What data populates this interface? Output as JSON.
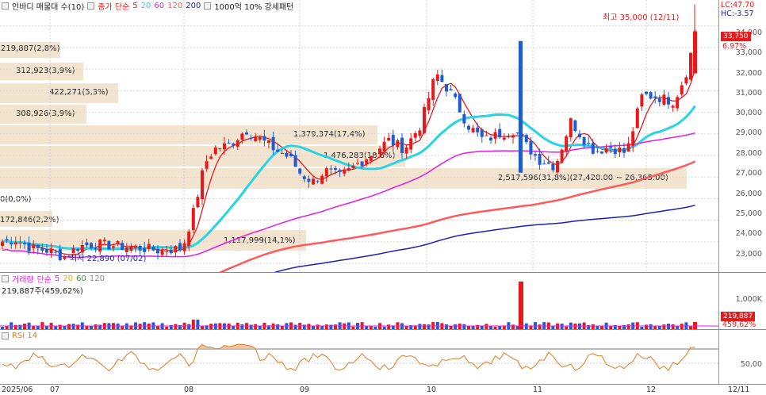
{
  "price_panel": {
    "legend": {
      "title": "인바디 매물대 수(10)",
      "ma_label": "종가 단순",
      "ma_periods": [
        "5",
        "20",
        "60",
        "120",
        "200"
      ],
      "ma_colors": [
        "#e8191a",
        "#26d4e4",
        "#e51be6",
        "#ff5a5a",
        "#2020b0"
      ],
      "extra": "1000억 10% 강세패턴"
    },
    "corner": {
      "lc": "LC:47.70",
      "hc": "HC:-3.57"
    },
    "high_note": "최고 35,000 (12/11)",
    "low_note": "최저 22,890 (07/02)",
    "current_price": "33,750",
    "current_change": "6.97%",
    "y_ticks": [
      "34,000",
      "33,000",
      "32,000",
      "31,000",
      "30,000",
      "29,000",
      "28,000",
      "27,000",
      "26,000",
      "25,000",
      "24,000",
      "23,000"
    ],
    "volume_profile": [
      {
        "label": "219,887(2,8%)"
      },
      {
        "label": "312,923(3,9%)"
      },
      {
        "label": "422,271(5,3%)"
      },
      {
        "label": "308,926(3,9%)"
      },
      {
        "label": "1,379,374(17,4%)"
      },
      {
        "label": "1,476,283(18,6%)"
      },
      {
        "label": "2,517,596(31,8%)(27,420.00 ~ 26,365.00)"
      },
      {
        "label": "0(0,0%)"
      },
      {
        "label": "172,846(2,2%)"
      },
      {
        "label": "1,117,999(14,1%)"
      }
    ]
  },
  "volume_panel": {
    "legend": {
      "title": "거래량",
      "ma_label": "단순",
      "periods": [
        "5",
        "20",
        "60",
        "120"
      ]
    },
    "sub": "219,887주(459,62%)",
    "tick": "1,000K",
    "current": "219,887",
    "current_pct": "459,62%"
  },
  "rsi_panel": {
    "legend": "RSI 14",
    "tick": "50,00"
  },
  "x_axis": {
    "dates": [
      "2025/06",
      "07",
      "08",
      "09",
      "10",
      "11",
      "12",
      "12/11"
    ]
  },
  "chart_data": {
    "type": "candlestick",
    "title": "인바디 매물대 수(10)",
    "ylabel": "",
    "ylim": [
      22600,
      35200
    ],
    "x_range": [
      "2025/06",
      "2025/12/11"
    ],
    "high": {
      "value": 35000,
      "date": "12/11"
    },
    "low": {
      "value": 22890,
      "date": "07/02"
    },
    "last_close": 33750,
    "change_pct": 6.97,
    "series": [
      {
        "name": "5",
        "type": "ma",
        "color": "#e8191a"
      },
      {
        "name": "20",
        "type": "ma",
        "color": "#26d4e4"
      },
      {
        "name": "60",
        "type": "ma",
        "color": "#e51be6"
      },
      {
        "name": "120",
        "type": "ma",
        "color": "#ff5a5a"
      },
      {
        "name": "200",
        "type": "ma",
        "color": "#2020b0"
      }
    ],
    "volume_profile_bins": [
      {
        "volume": 219887,
        "pct": 2.8
      },
      {
        "volume": 312923,
        "pct": 3.9
      },
      {
        "volume": 422271,
        "pct": 5.3
      },
      {
        "volume": 308926,
        "pct": 3.9
      },
      {
        "volume": 1379374,
        "pct": 17.4
      },
      {
        "volume": 1476283,
        "pct": 18.6
      },
      {
        "volume": 2517596,
        "pct": 31.8
      },
      {
        "volume": 0,
        "pct": 0.0
      },
      {
        "volume": 172846,
        "pct": 2.2
      },
      {
        "volume": 1117999,
        "pct": 14.1
      }
    ],
    "last_volume": 219887,
    "volume_ratio_pct": 459.62,
    "rsi_period": 14,
    "rsi_reference": 50
  }
}
